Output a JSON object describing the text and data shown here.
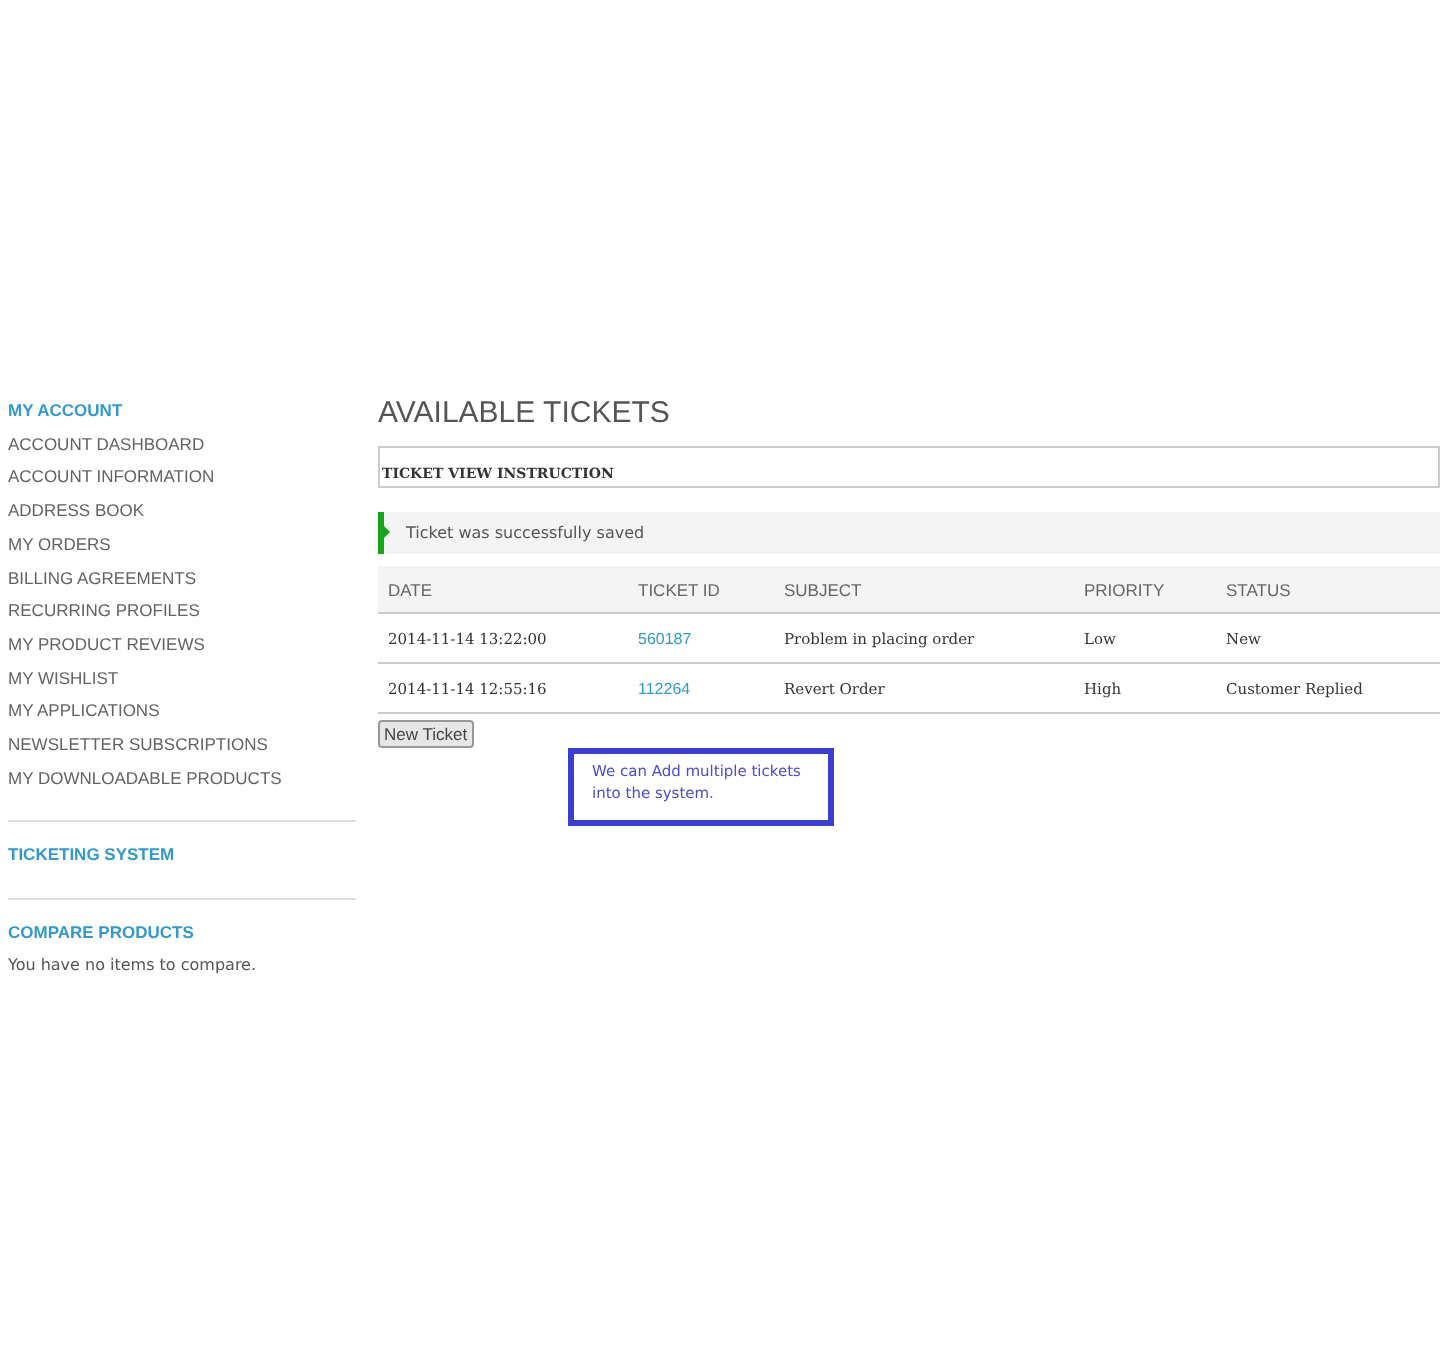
{
  "sidebar": {
    "title": "MY ACCOUNT",
    "items": [
      "ACCOUNT DASHBOARD",
      "ACCOUNT INFORMATION",
      "ADDRESS BOOK",
      "MY ORDERS",
      "BILLING AGREEMENTS",
      "RECURRING PROFILES",
      "MY PRODUCT REVIEWS",
      "MY WISHLIST",
      "MY APPLICATIONS",
      "NEWSLETTER SUBSCRIPTIONS",
      "MY DOWNLOADABLE PRODUCTS"
    ],
    "ticketing_title": "TICKETING SYSTEM",
    "compare_title": "COMPARE PRODUCTS",
    "compare_text": "You have no items to compare."
  },
  "main": {
    "title": "AVAILABLE TICKETS",
    "instruction": "TICKET VIEW INSTRUCTION",
    "message": "Ticket was successfully saved",
    "table": {
      "columns": [
        "DATE",
        "TICKET ID",
        "SUBJECT",
        "PRIORITY",
        "STATUS"
      ],
      "rows": [
        {
          "date": "2014-11-14 13:22:00",
          "ticket_id": "560187",
          "subject": "Problem in placing order",
          "priority": "Low",
          "status": "New"
        },
        {
          "date": "2014-11-14 12:55:16",
          "ticket_id": "112264",
          "subject": "Revert Order",
          "priority": "High",
          "status": "Customer Replied"
        }
      ]
    },
    "new_button": "New Ticket",
    "callout": "We can Add multiple tickets into the system."
  }
}
